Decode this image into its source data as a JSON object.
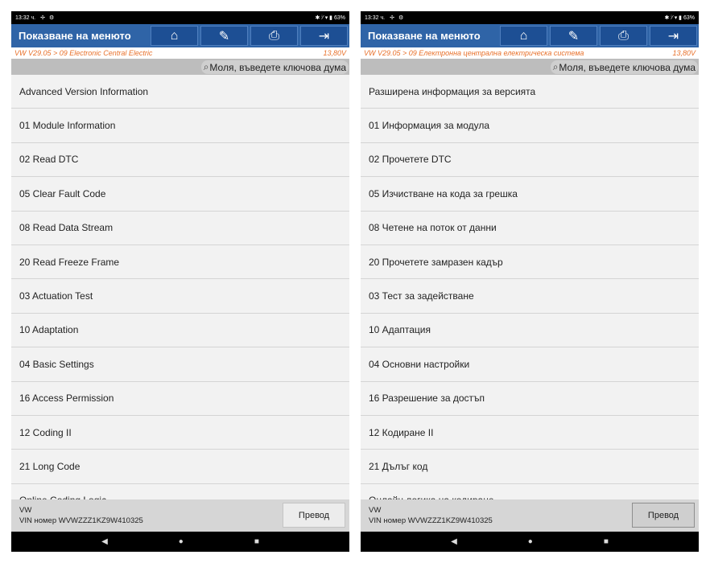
{
  "panels": [
    {
      "status": {
        "time": "13:32 ч.",
        "icon1": "✢",
        "icon2": "⚙",
        "right": "✱ ⁱ⁄ ▾ ▮ 63%"
      },
      "title": "Показване на менюто",
      "breadcrumb": "VW V29.05 > 09 Electronic Central Electric",
      "voltage": "13,80V",
      "search_placeholder": "Моля, въведете ключова дума",
      "menu": [
        "Advanced Version Information",
        "01 Module Information",
        "02 Read DTC",
        "05 Clear Fault Code",
        "08 Read Data Stream",
        "20 Read Freeze Frame",
        "03 Actuation Test",
        "10 Adaptation",
        "04 Basic Settings",
        "16 Access Permission",
        "12 Coding II",
        "21 Long Code",
        "Online Coding Logic"
      ],
      "footer": {
        "make": "VW",
        "vin": "VIN номер WVWZZZ1KZ9W410325",
        "button": "Превод"
      }
    },
    {
      "status": {
        "time": "13:32 ч.",
        "icon1": "✢",
        "icon2": "⚙",
        "right": "✱ ⁱ⁄ ▾ ▮ 63%"
      },
      "title": "Показване на менюто",
      "breadcrumb": "VW V29.05 > 09 Електронна централна електрическа система",
      "voltage": "13,80V",
      "search_placeholder": "Моля, въведете ключова дума",
      "menu": [
        "Разширена информация за версията",
        "01 Информация за модула",
        "02 Прочетете DTC",
        "05 Изчистване на кода за грешка",
        "08 Четене на поток от данни",
        "20 Прочетете замразен кадър",
        "03 Тест за задействане",
        "10 Адаптация",
        "04 Основни настройки",
        "16 Разрешение за достъп",
        "12 Кодиране II",
        "21 Дълъг код",
        "Онлайн логика на кодиране"
      ],
      "footer": {
        "make": "VW",
        "vin": "VIN номер WVWZZZ1KZ9W410325",
        "button": "Превод"
      }
    }
  ],
  "toolbar_icons": [
    "home-icon",
    "edit-report-icon",
    "print-icon",
    "exit-icon"
  ],
  "nav": {
    "back": "◀",
    "home": "●",
    "recents": "■"
  },
  "colors": {
    "titlebar": "#2f64a7",
    "breadcrumb": "#e8702a",
    "list_bg": "#f2f2f2",
    "footer_bg": "#d6d6d6"
  }
}
